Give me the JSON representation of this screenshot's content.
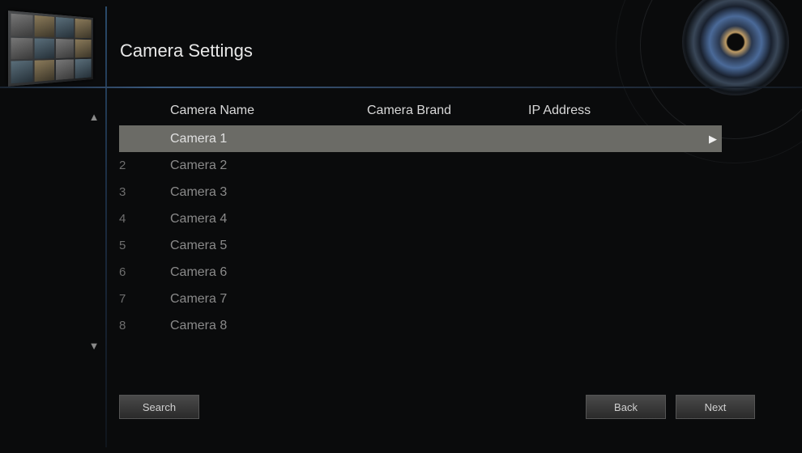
{
  "header": {
    "title": "Camera Settings"
  },
  "columns": {
    "name": "Camera Name",
    "brand": "Camera Brand",
    "ip": "IP Address"
  },
  "rows": [
    {
      "number": "",
      "name": "Camera 1",
      "selected": true
    },
    {
      "number": "2",
      "name": "Camera 2"
    },
    {
      "number": "3",
      "name": "Camera 3"
    },
    {
      "number": "4",
      "name": "Camera 4"
    },
    {
      "number": "5",
      "name": "Camera 5"
    },
    {
      "number": "6",
      "name": "Camera 6"
    },
    {
      "number": "7",
      "name": "Camera 7"
    },
    {
      "number": "8",
      "name": "Camera 8"
    }
  ],
  "buttons": {
    "search": "Search",
    "back": "Back",
    "next": "Next"
  },
  "icons": {
    "scroll_up": "▲",
    "scroll_down": "▼",
    "selected_row": "▶"
  },
  "colors": {
    "background": "#0a0b0c",
    "selection": "#6b6b66",
    "accent_line": "#3a5a80"
  }
}
